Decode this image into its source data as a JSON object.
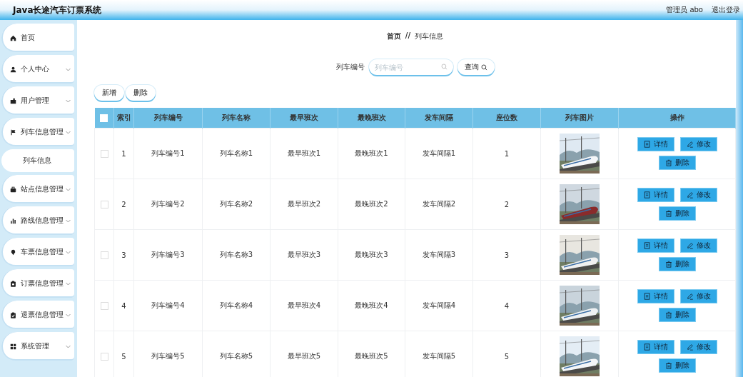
{
  "header": {
    "title": "Java长途汽车订票系统",
    "user": "管理员 abo",
    "logout": "退出登录"
  },
  "sidebar": {
    "items": [
      {
        "label": "首页",
        "kind": "link"
      },
      {
        "label": "个人中心",
        "kind": "menu"
      },
      {
        "label": "用户管理",
        "kind": "menu"
      },
      {
        "label": "列车信息管理",
        "kind": "menu",
        "children": [
          {
            "label": "列车信息"
          }
        ]
      },
      {
        "label": "站点信息管理",
        "kind": "menu"
      },
      {
        "label": "路线信息管理",
        "kind": "menu"
      },
      {
        "label": "车票信息管理",
        "kind": "menu"
      },
      {
        "label": "订票信息管理",
        "kind": "menu"
      },
      {
        "label": "退票信息管理",
        "kind": "menu"
      },
      {
        "label": "系统管理",
        "kind": "menu"
      }
    ]
  },
  "breadcrumb": {
    "items": [
      "首页",
      "列车信息"
    ],
    "separator": "//"
  },
  "search": {
    "label": "列车编号",
    "placeholder": "列车编号",
    "button": "查询"
  },
  "toolbar": [
    "新增",
    "删除"
  ],
  "table": {
    "select_all": false,
    "columns": [
      "索引",
      "列车编号",
      "列车名称",
      "最早班次",
      "最晚班次",
      "发车间隔",
      "座位数",
      "列车图片",
      "操作"
    ],
    "rows": [
      {
        "checked": false,
        "cells": [
          "1",
          "列车编号1",
          "列车名称1",
          "最早班次1",
          "最晚班次1",
          "发车间隔1",
          "1"
        ],
        "actions": [
          "详情",
          "修改",
          "删除"
        ]
      },
      {
        "checked": false,
        "cells": [
          "2",
          "列车编号2",
          "列车名称2",
          "最早班次2",
          "最晚班次2",
          "发车间隔2",
          "2"
        ],
        "actions": [
          "详情",
          "修改",
          "删除"
        ]
      },
      {
        "checked": false,
        "cells": [
          "3",
          "列车编号3",
          "列车名称3",
          "最早班次3",
          "最晚班次3",
          "发车间隔3",
          "3"
        ],
        "actions": [
          "详情",
          "修改",
          "删除"
        ]
      },
      {
        "checked": false,
        "cells": [
          "4",
          "列车编号4",
          "列车名称4",
          "最早班次4",
          "最晚班次4",
          "发车间隔4",
          "4"
        ],
        "actions": [
          "详情",
          "修改",
          "删除"
        ]
      },
      {
        "checked": false,
        "cells": [
          "5",
          "列车编号5",
          "列车名称5",
          "最早班次5",
          "最晚班次5",
          "发车间隔5",
          "5"
        ],
        "actions": [
          "详情",
          "修改",
          "删除"
        ]
      }
    ]
  }
}
